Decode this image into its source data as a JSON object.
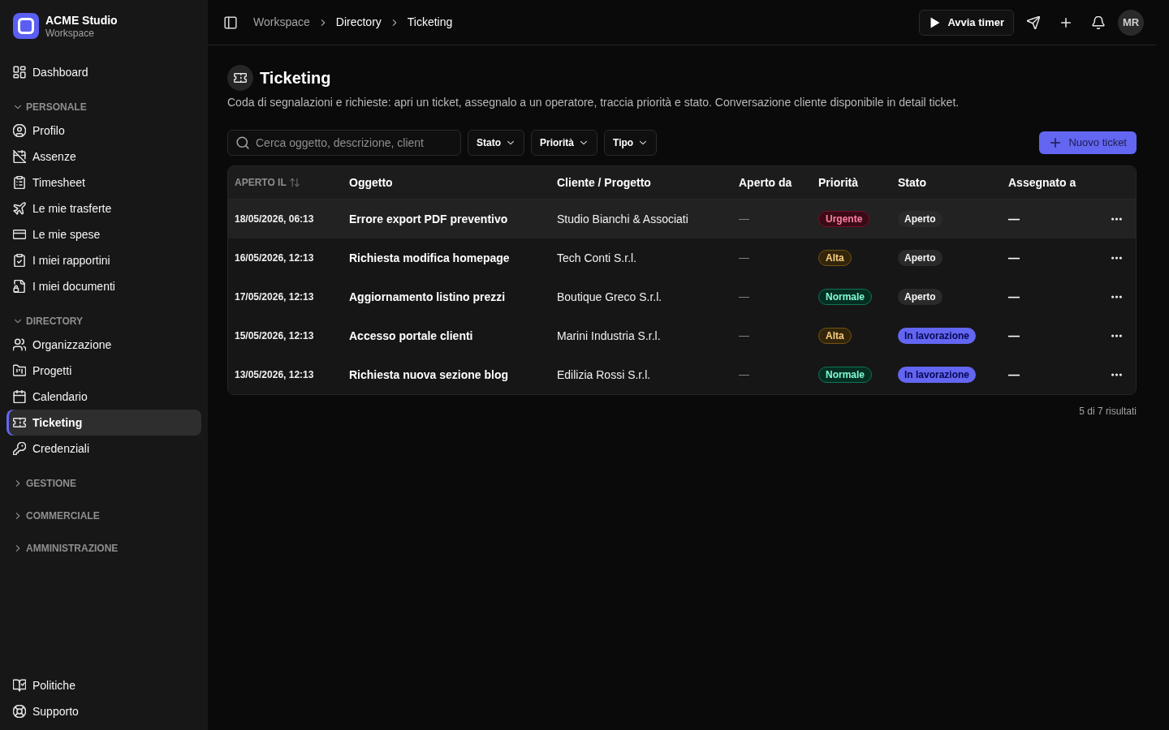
{
  "sidebar": {
    "brand": {
      "name": "ACME Studio",
      "subtitle": "Workspace"
    },
    "top_items": [
      {
        "label": "Dashboard",
        "selected": false
      }
    ],
    "sections": [
      {
        "title": "PERSONALE",
        "expanded": true,
        "items": [
          {
            "label": "Profilo",
            "selected": false
          },
          {
            "label": "Assenze",
            "selected": false
          },
          {
            "label": "Timesheet",
            "selected": false
          },
          {
            "label": "Le mie trasferte",
            "selected": false
          },
          {
            "label": "Le mie spese",
            "selected": false
          },
          {
            "label": "I miei rapportini",
            "selected": false
          },
          {
            "label": "I miei documenti",
            "selected": false
          }
        ]
      },
      {
        "title": "DIRECTORY",
        "expanded": true,
        "items": [
          {
            "label": "Organizzazione",
            "selected": false
          },
          {
            "label": "Progetti",
            "selected": false
          },
          {
            "label": "Calendario",
            "selected": false
          },
          {
            "label": "Ticketing",
            "selected": true
          },
          {
            "label": "Credenziali",
            "selected": false
          }
        ]
      },
      {
        "title": "GESTIONE",
        "expanded": false
      },
      {
        "title": "COMMERCIALE",
        "expanded": false
      },
      {
        "title": "AMMINISTRAZIONE",
        "expanded": false
      }
    ],
    "bottom_items": [
      {
        "label": "Politiche",
        "selected": false
      },
      {
        "label": "Supporto",
        "selected": false
      }
    ]
  },
  "topbar": {
    "breadcrumbs": [
      {
        "label": "Workspace",
        "muted": true
      },
      {
        "label": "Directory",
        "muted": false
      },
      {
        "label": "Ticketing",
        "muted": false
      }
    ],
    "timer_button": {
      "label": "Avvia timer"
    },
    "avatar": "MR"
  },
  "page": {
    "title": "Ticketing",
    "description": "Coda di segnalazioni e richieste: apri un ticket, assegnalo a un operatore, traccia priorità e stato. Conversazione cliente disponibile in detail ticket."
  },
  "toolbar": {
    "search": {
      "placeholder": "Cerca oggetto, descrizione, client"
    },
    "filters": [
      "Stato",
      "Priorità",
      "Tipo"
    ],
    "new_button": "Nuovo ticket"
  },
  "table": {
    "columns": [
      {
        "label": "APERTO IL",
        "sortable": true
      },
      {
        "label": "Oggetto",
        "sortable": false
      },
      {
        "label": "Cliente / Progetto",
        "sortable": false
      },
      {
        "label": "Aperto da",
        "sortable": false
      },
      {
        "label": "Priorità",
        "sortable": false
      },
      {
        "label": "Stato",
        "sortable": false
      },
      {
        "label": "Assegnato a",
        "sortable": false
      }
    ],
    "rows": [
      {
        "opened": "18/05/2026, 06:13",
        "subject": "Errore export PDF preventivo",
        "client": "Studio Bianchi & Associati",
        "opened_by": "—",
        "priority": {
          "label": "Urgente",
          "color": "#3b0a17"
        },
        "status": {
          "label": "Aperto",
          "color": "#2a2a2a"
        },
        "assignee": "—",
        "hovered": true
      },
      {
        "opened": "16/05/2026, 12:13",
        "subject": "Richiesta modifica homepage",
        "client": "Tech Conti S.r.l.",
        "opened_by": "—",
        "priority": {
          "label": "Alta",
          "color": "#33250a"
        },
        "status": {
          "label": "Aperto",
          "color": "#2a2a2a"
        },
        "assignee": "—",
        "hovered": false
      },
      {
        "opened": "17/05/2026, 12:13",
        "subject": "Aggiornamento listino prezzi",
        "client": "Boutique Greco S.r.l.",
        "opened_by": "—",
        "priority": {
          "label": "Normale",
          "color": "#052e22"
        },
        "status": {
          "label": "Aperto",
          "color": "#2a2a2a"
        },
        "assignee": "—",
        "hovered": false
      },
      {
        "opened": "15/05/2026, 12:13",
        "subject": "Accesso portale clienti",
        "client": "Marini Industria S.r.l.",
        "opened_by": "—",
        "priority": {
          "label": "Alta",
          "color": "#33250a"
        },
        "status": {
          "label": "In lavorazione",
          "color": "#6366f1"
        },
        "assignee": "—",
        "hovered": false
      },
      {
        "opened": "13/05/2026, 12:13",
        "subject": "Richiesta nuova sezione blog",
        "client": "Edilizia Rossi S.r.l.",
        "opened_by": "—",
        "priority": {
          "label": "Normale",
          "color": "#052e22"
        },
        "status": {
          "label": "In lavorazione",
          "color": "#6366f1"
        },
        "assignee": "—",
        "hovered": false
      }
    ]
  },
  "footer": {
    "result_count": "5 di 7 risultati"
  }
}
